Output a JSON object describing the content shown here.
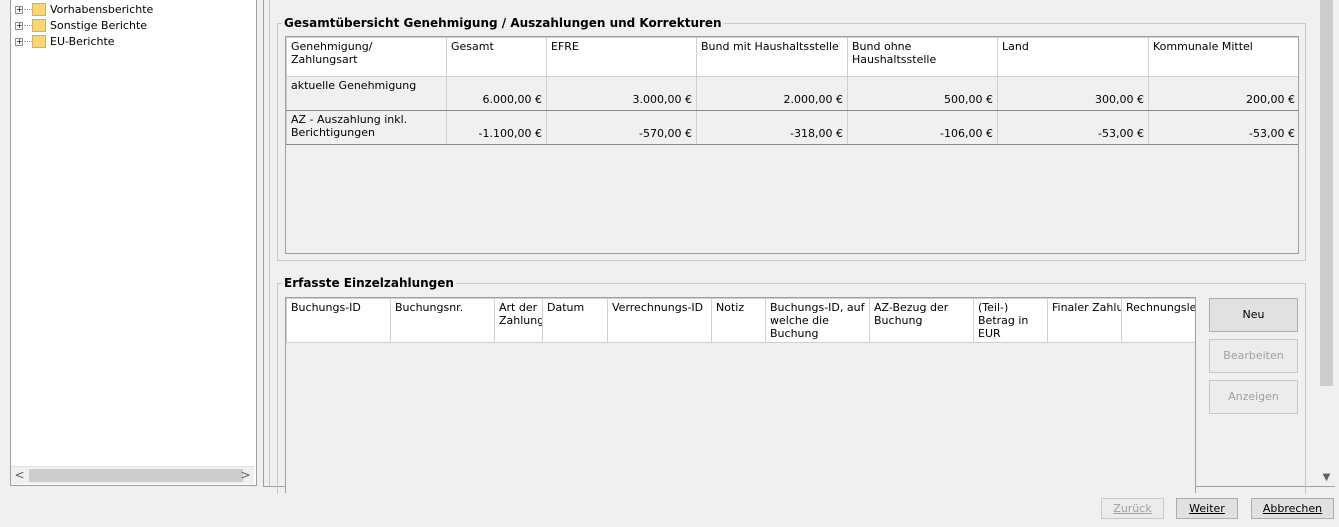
{
  "tree": {
    "items": [
      {
        "label": "Vorhabensberichte"
      },
      {
        "label": "Sonstige Berichte"
      },
      {
        "label": "EU-Berichte"
      }
    ],
    "scroll_left_glyph": "<",
    "scroll_right_glyph": ">"
  },
  "overview": {
    "title": "Gesamtübersicht Genehmigung / Auszahlungen und Korrekturen",
    "headers": [
      "Genehmigung/ Zahlungsart",
      "Gesamt",
      "EFRE",
      "Bund mit Haushaltsstelle",
      "Bund ohne Haushaltsstelle",
      "Land",
      "Kommunale Mittel"
    ],
    "rows": [
      [
        "aktuelle Genehmigung",
        "6.000,00 €",
        "3.000,00 €",
        "2.000,00 €",
        "500,00 €",
        "300,00 €",
        "200,00 €"
      ],
      [
        "AZ - Auszahlung inkl. Berichtigungen",
        "-1.100,00 €",
        "-570,00 €",
        "-318,00 €",
        "-106,00 €",
        "-53,00 €",
        "-53,00 €"
      ]
    ]
  },
  "payments": {
    "title": "Erfasste Einzelzahlungen",
    "headers": [
      "Buchungs-ID",
      "Buchungsnr.",
      "Art der Zahlung",
      "Datum",
      "Verrechnungs-ID",
      "Notiz",
      "Buchungs-ID, auf welche die Buchung",
      "AZ-Bezug der Buchung",
      "(Teil-) Betrag in EUR",
      "Finaler Zahlungsantrag",
      "Rechnungslegung"
    ],
    "sort_glyph": "^",
    "buttons": {
      "new": "Neu",
      "edit": "Bearbeiten",
      "view": "Anzeigen"
    }
  },
  "footer": {
    "back": "Zurück",
    "next": "Weiter",
    "cancel": "Abbrechen"
  },
  "icons": {
    "expand": "plus-box-icon",
    "folder": "folder-icon"
  },
  "colors": {
    "folder": "#f6d675",
    "scroll_thumb": "#cdcdcd"
  }
}
